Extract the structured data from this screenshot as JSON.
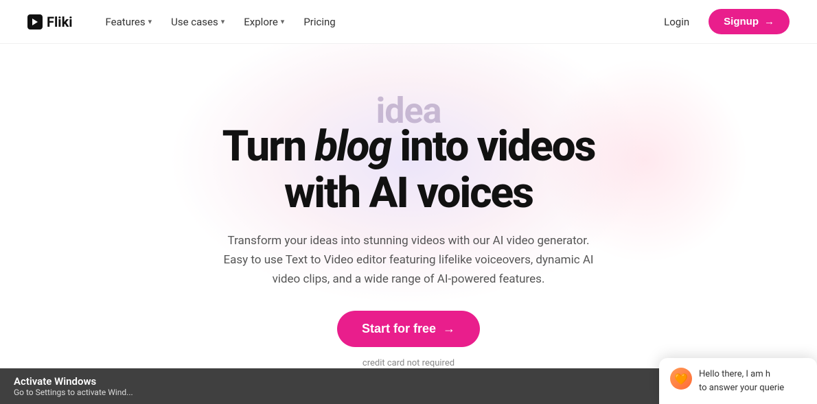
{
  "brand": {
    "name": "Fliki",
    "logo_icon": "F"
  },
  "navbar": {
    "features_label": "Features",
    "use_cases_label": "Use cases",
    "explore_label": "Explore",
    "pricing_label": "Pricing",
    "login_label": "Login",
    "signup_label": "Signup",
    "signup_arrow": "→"
  },
  "hero": {
    "idea_text": "idea",
    "title_line1": "Turn blog into videos",
    "title_line2": "with AI voices",
    "highlight_word": "blog",
    "subtitle_line1": "Transform your ideas into stunning videos with our AI video generator.",
    "subtitle_line2": "Easy to use Text to Video editor featuring lifelike voiceovers, dynamic AI",
    "subtitle_line3": "video clips, and a wide range of AI-powered features.",
    "cta_label": "Start for free",
    "cta_arrow": "→",
    "credit_note": "credit card not required"
  },
  "chat_widget": {
    "avatar_emoji": "🧡",
    "message_line1": "Hello there, I am h",
    "message_line2": "to answer your querie"
  },
  "windows_bar": {
    "title": "Activate Windows",
    "subtitle": "Go to Settings to activate Wind..."
  }
}
